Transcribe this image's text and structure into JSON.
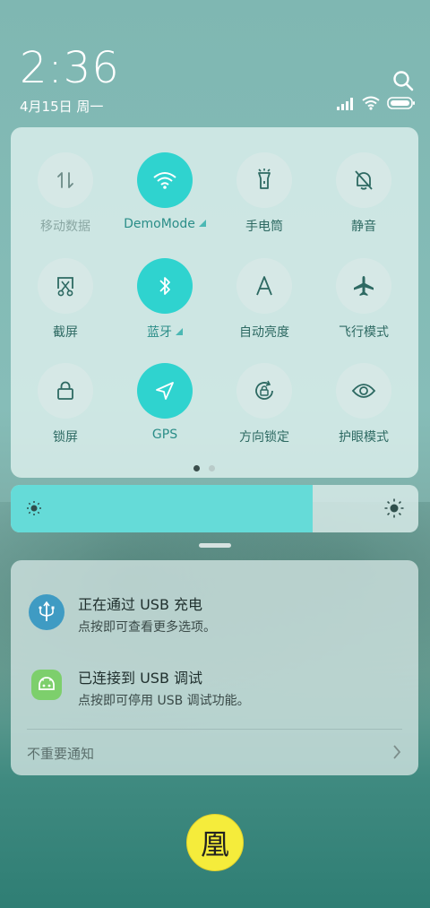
{
  "status": {
    "time": "2:36",
    "date": "4月15日 周一"
  },
  "tiles": [
    {
      "label": "移动数据",
      "icon": "mobile-data-icon",
      "active": false
    },
    {
      "label": "DemoMode",
      "icon": "wifi-icon",
      "active": true
    },
    {
      "label": "手电筒",
      "icon": "flashlight-icon",
      "active": false
    },
    {
      "label": "静音",
      "icon": "bell-off-icon",
      "active": false
    },
    {
      "label": "截屏",
      "icon": "screenshot-icon",
      "active": false
    },
    {
      "label": "蓝牙",
      "icon": "bluetooth-icon",
      "active": true
    },
    {
      "label": "自动亮度",
      "icon": "auto-brightness-icon",
      "active": false
    },
    {
      "label": "飞行模式",
      "icon": "airplane-icon",
      "active": false
    },
    {
      "label": "锁屏",
      "icon": "lock-icon",
      "active": false
    },
    {
      "label": "GPS",
      "icon": "location-arrow-icon",
      "active": true
    },
    {
      "label": "方向锁定",
      "icon": "rotation-lock-icon",
      "active": false
    },
    {
      "label": "护眼模式",
      "icon": "eye-icon",
      "active": false
    }
  ],
  "page_indicator": {
    "current": 1,
    "total": 2
  },
  "brightness": {
    "level": 0.74
  },
  "notifications": [
    {
      "title": "正在通过 USB 充电",
      "subtitle": "点按即可查看更多选项。",
      "icon": "usb-icon"
    },
    {
      "title": "已连接到 USB 调试",
      "subtitle": "点按即可停用 USB 调试功能。",
      "icon": "android-icon"
    }
  ],
  "less_important": "不重要通知",
  "fab": {
    "glyph": "凰"
  },
  "colors": {
    "accent": "#2fd3cf",
    "brightness_fill": "#65dbd8",
    "fab": "#f5ec3b"
  }
}
